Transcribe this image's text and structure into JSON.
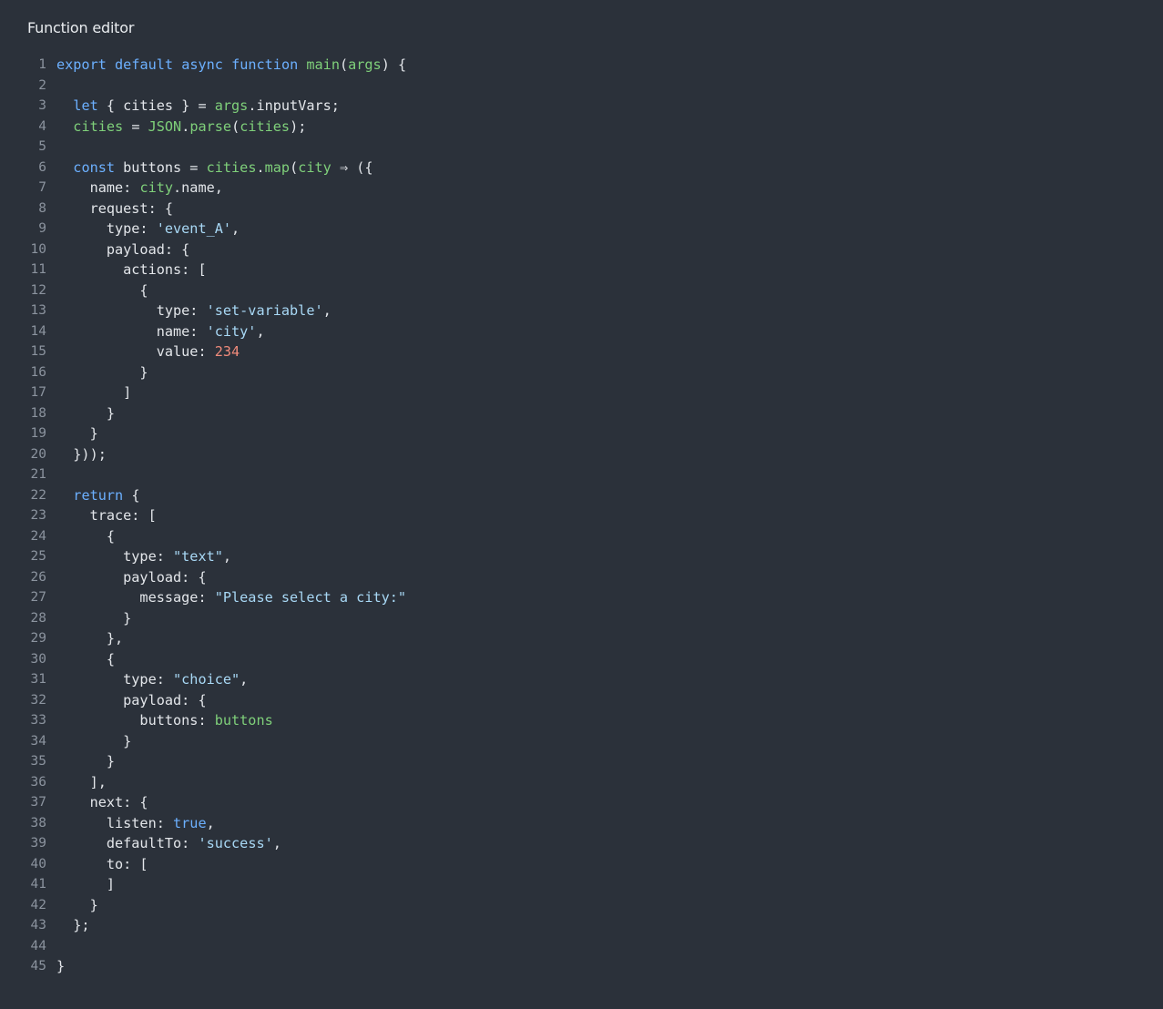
{
  "editor": {
    "title": "Function editor"
  },
  "colors": {
    "background": "#2b313a",
    "keyword": "#6cb0ff",
    "function": "#7fd07a",
    "string": "#a8d8f5",
    "number": "#f08b7b",
    "plain": "#e3e6ea",
    "line_number": "#8b939e"
  },
  "code": {
    "lines": [
      {
        "n": "1",
        "tokens": [
          {
            "t": "export",
            "c": "kw"
          },
          {
            "t": " ",
            "c": "pl"
          },
          {
            "t": "default",
            "c": "kw"
          },
          {
            "t": " ",
            "c": "pl"
          },
          {
            "t": "async",
            "c": "kw"
          },
          {
            "t": " ",
            "c": "pl"
          },
          {
            "t": "function",
            "c": "kw"
          },
          {
            "t": " ",
            "c": "pl"
          },
          {
            "t": "main",
            "c": "fn"
          },
          {
            "t": "(",
            "c": "pl"
          },
          {
            "t": "args",
            "c": "fn"
          },
          {
            "t": ") {",
            "c": "pl"
          }
        ]
      },
      {
        "n": "2",
        "tokens": []
      },
      {
        "n": "3",
        "tokens": [
          {
            "t": "  ",
            "c": "pl"
          },
          {
            "t": "let",
            "c": "kw"
          },
          {
            "t": " { cities } = ",
            "c": "pl"
          },
          {
            "t": "args",
            "c": "fn"
          },
          {
            "t": ".inputVars;",
            "c": "pl"
          }
        ]
      },
      {
        "n": "4",
        "tokens": [
          {
            "t": "  ",
            "c": "pl"
          },
          {
            "t": "cities",
            "c": "fn"
          },
          {
            "t": " = ",
            "c": "pl"
          },
          {
            "t": "JSON",
            "c": "fn"
          },
          {
            "t": ".",
            "c": "pl"
          },
          {
            "t": "parse",
            "c": "fn"
          },
          {
            "t": "(",
            "c": "pl"
          },
          {
            "t": "cities",
            "c": "fn"
          },
          {
            "t": ");",
            "c": "pl"
          }
        ]
      },
      {
        "n": "5",
        "tokens": []
      },
      {
        "n": "6",
        "tokens": [
          {
            "t": "  ",
            "c": "pl"
          },
          {
            "t": "const",
            "c": "kw"
          },
          {
            "t": " buttons = ",
            "c": "pl"
          },
          {
            "t": "cities",
            "c": "fn"
          },
          {
            "t": ".",
            "c": "pl"
          },
          {
            "t": "map",
            "c": "fn"
          },
          {
            "t": "(",
            "c": "pl"
          },
          {
            "t": "city",
            "c": "fn"
          },
          {
            "t": " ⇒ ({",
            "c": "pl"
          }
        ]
      },
      {
        "n": "7",
        "tokens": [
          {
            "t": "    name: ",
            "c": "pl"
          },
          {
            "t": "city",
            "c": "fn"
          },
          {
            "t": ".name,",
            "c": "pl"
          }
        ]
      },
      {
        "n": "8",
        "tokens": [
          {
            "t": "    request: {",
            "c": "pl"
          }
        ]
      },
      {
        "n": "9",
        "tokens": [
          {
            "t": "      type: ",
            "c": "pl"
          },
          {
            "t": "'event_A'",
            "c": "str"
          },
          {
            "t": ",",
            "c": "pl"
          }
        ]
      },
      {
        "n": "10",
        "tokens": [
          {
            "t": "      payload: {",
            "c": "pl"
          }
        ]
      },
      {
        "n": "11",
        "tokens": [
          {
            "t": "        actions: [",
            "c": "pl"
          }
        ]
      },
      {
        "n": "12",
        "tokens": [
          {
            "t": "          {",
            "c": "pl"
          }
        ]
      },
      {
        "n": "13",
        "tokens": [
          {
            "t": "            type: ",
            "c": "pl"
          },
          {
            "t": "'set-variable'",
            "c": "str"
          },
          {
            "t": ",",
            "c": "pl"
          }
        ]
      },
      {
        "n": "14",
        "tokens": [
          {
            "t": "            name: ",
            "c": "pl"
          },
          {
            "t": "'city'",
            "c": "str"
          },
          {
            "t": ",",
            "c": "pl"
          }
        ]
      },
      {
        "n": "15",
        "tokens": [
          {
            "t": "            value: ",
            "c": "pl"
          },
          {
            "t": "234",
            "c": "num"
          }
        ]
      },
      {
        "n": "16",
        "tokens": [
          {
            "t": "          }",
            "c": "pl"
          }
        ]
      },
      {
        "n": "17",
        "tokens": [
          {
            "t": "        ]",
            "c": "pl"
          }
        ]
      },
      {
        "n": "18",
        "tokens": [
          {
            "t": "      }",
            "c": "pl"
          }
        ]
      },
      {
        "n": "19",
        "tokens": [
          {
            "t": "    }",
            "c": "pl"
          }
        ]
      },
      {
        "n": "20",
        "tokens": [
          {
            "t": "  }));",
            "c": "pl"
          }
        ]
      },
      {
        "n": "21",
        "tokens": []
      },
      {
        "n": "22",
        "tokens": [
          {
            "t": "  ",
            "c": "pl"
          },
          {
            "t": "return",
            "c": "kw"
          },
          {
            "t": " {",
            "c": "pl"
          }
        ]
      },
      {
        "n": "23",
        "tokens": [
          {
            "t": "    trace: [",
            "c": "pl"
          }
        ]
      },
      {
        "n": "24",
        "tokens": [
          {
            "t": "      {",
            "c": "pl"
          }
        ]
      },
      {
        "n": "25",
        "tokens": [
          {
            "t": "        type: ",
            "c": "pl"
          },
          {
            "t": "\"text\"",
            "c": "str"
          },
          {
            "t": ",",
            "c": "pl"
          }
        ]
      },
      {
        "n": "26",
        "tokens": [
          {
            "t": "        payload: {",
            "c": "pl"
          }
        ]
      },
      {
        "n": "27",
        "tokens": [
          {
            "t": "          message: ",
            "c": "pl"
          },
          {
            "t": "\"Please select a city:\"",
            "c": "str"
          }
        ]
      },
      {
        "n": "28",
        "tokens": [
          {
            "t": "        }",
            "c": "pl"
          }
        ]
      },
      {
        "n": "29",
        "tokens": [
          {
            "t": "      },",
            "c": "pl"
          }
        ]
      },
      {
        "n": "30",
        "tokens": [
          {
            "t": "      {",
            "c": "pl"
          }
        ]
      },
      {
        "n": "31",
        "tokens": [
          {
            "t": "        type: ",
            "c": "pl"
          },
          {
            "t": "\"choice\"",
            "c": "str"
          },
          {
            "t": ",",
            "c": "pl"
          }
        ]
      },
      {
        "n": "32",
        "tokens": [
          {
            "t": "        payload: {",
            "c": "pl"
          }
        ]
      },
      {
        "n": "33",
        "tokens": [
          {
            "t": "          buttons: ",
            "c": "pl"
          },
          {
            "t": "buttons",
            "c": "fn"
          }
        ]
      },
      {
        "n": "34",
        "tokens": [
          {
            "t": "        }",
            "c": "pl"
          }
        ]
      },
      {
        "n": "35",
        "tokens": [
          {
            "t": "      }",
            "c": "pl"
          }
        ]
      },
      {
        "n": "36",
        "tokens": [
          {
            "t": "    ],",
            "c": "pl"
          }
        ]
      },
      {
        "n": "37",
        "tokens": [
          {
            "t": "    next: {",
            "c": "pl"
          }
        ]
      },
      {
        "n": "38",
        "tokens": [
          {
            "t": "      listen: ",
            "c": "pl"
          },
          {
            "t": "true",
            "c": "kw"
          },
          {
            "t": ",",
            "c": "pl"
          }
        ]
      },
      {
        "n": "39",
        "tokens": [
          {
            "t": "      defaultTo: ",
            "c": "pl"
          },
          {
            "t": "'success'",
            "c": "str"
          },
          {
            "t": ",",
            "c": "pl"
          }
        ]
      },
      {
        "n": "40",
        "tokens": [
          {
            "t": "      to: [",
            "c": "pl"
          }
        ]
      },
      {
        "n": "41",
        "tokens": [
          {
            "t": "      ]",
            "c": "pl"
          }
        ]
      },
      {
        "n": "42",
        "tokens": [
          {
            "t": "    }",
            "c": "pl"
          }
        ]
      },
      {
        "n": "43",
        "tokens": [
          {
            "t": "  };",
            "c": "pl"
          }
        ]
      },
      {
        "n": "44",
        "tokens": []
      },
      {
        "n": "45",
        "tokens": [
          {
            "t": "}",
            "c": "pl"
          }
        ]
      }
    ]
  }
}
